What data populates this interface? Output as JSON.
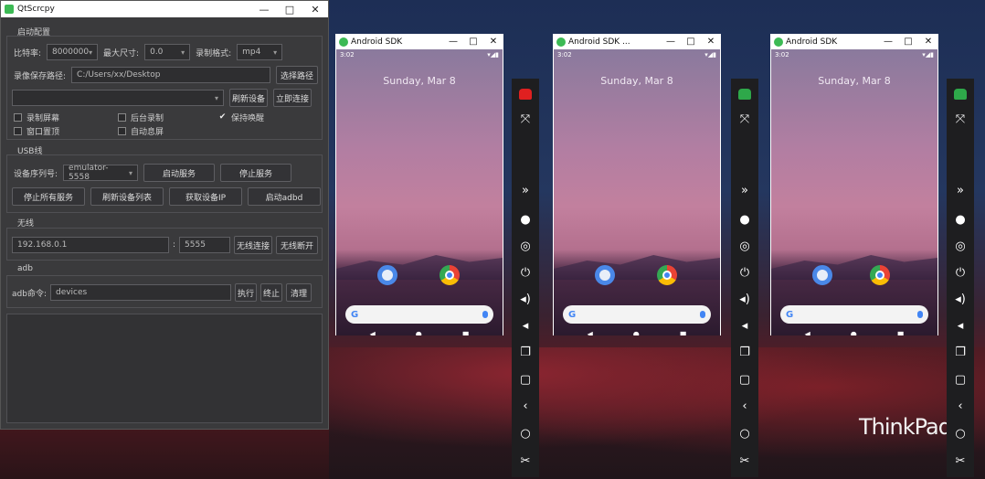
{
  "main_window": {
    "title": "QtScrcpy",
    "controls": {
      "minimize": "—",
      "maximize": "□",
      "close": "✕"
    },
    "config_section": "启动配置",
    "bitrate_label": "比特率:",
    "bitrate_value": "8000000",
    "max_size_label": "最大尺寸:",
    "max_size_value": "0.0",
    "record_format_label": "录制格式:",
    "record_format_value": "mp4",
    "record_path_label": "录像保存路径:",
    "record_path_value": "C:/Users/xx/Desktop",
    "select_path_button": "选择路径",
    "refresh_button": "刷新设备",
    "connect_button": "立即连接",
    "checks": [
      {
        "label": "录制屏幕",
        "checked": false
      },
      {
        "label": "后台录制",
        "checked": false
      },
      {
        "label": "保持唤醒",
        "checked": true
      },
      {
        "label": "窗口置顶",
        "checked": false
      },
      {
        "label": "自动息屏",
        "checked": false
      }
    ],
    "usb_section": "USB线",
    "device_serial_label": "设备序列号:",
    "device_serial_value": "emulator-5558",
    "start_service_button": "启动服务",
    "stop_service_button": "停止服务",
    "stop_all_button": "停止所有服务",
    "refresh_devices_button": "刷新设备列表",
    "get_ip_button": "获取设备IP",
    "start_adbd_button": "启动adbd",
    "wireless_section": "无线",
    "ip_value": "192.168.0.1",
    "colon": ":",
    "port_value": "5555",
    "wireless_connect_button": "无线连接",
    "wireless_disconnect_button": "无线断开",
    "adb_section": "adb",
    "adb_command_label": "adb命令:",
    "adb_command_value": "devices",
    "execute_button": "执行",
    "terminate_button": "终止",
    "clear_button": "清理"
  },
  "emulators": [
    {
      "title": "Android SDK",
      "time": "3:02",
      "date": "Sunday, Mar 8",
      "robot_color": "#e02020"
    },
    {
      "title": "Android SDK ...",
      "time": "3:02",
      "date": "Sunday, Mar 8",
      "robot_color": "#2ea84a"
    },
    {
      "title": "Android SDK",
      "time": "3:02",
      "date": "Sunday, Mar 8",
      "robot_color": "#2ea84a"
    }
  ],
  "emulator_controls": {
    "minimize": "—",
    "maximize": "□",
    "close": "✕"
  },
  "toolbar_icons": [
    "robot-icon",
    "fullscreen-icon",
    "expand-icon",
    "record-icon",
    "hide-icon",
    "power-icon",
    "volume-up-icon",
    "volume-down-icon",
    "app-switch-icon",
    "home-icon",
    "back-icon",
    "circle-icon",
    "screenshot-icon"
  ],
  "brand": "ThinkPad"
}
